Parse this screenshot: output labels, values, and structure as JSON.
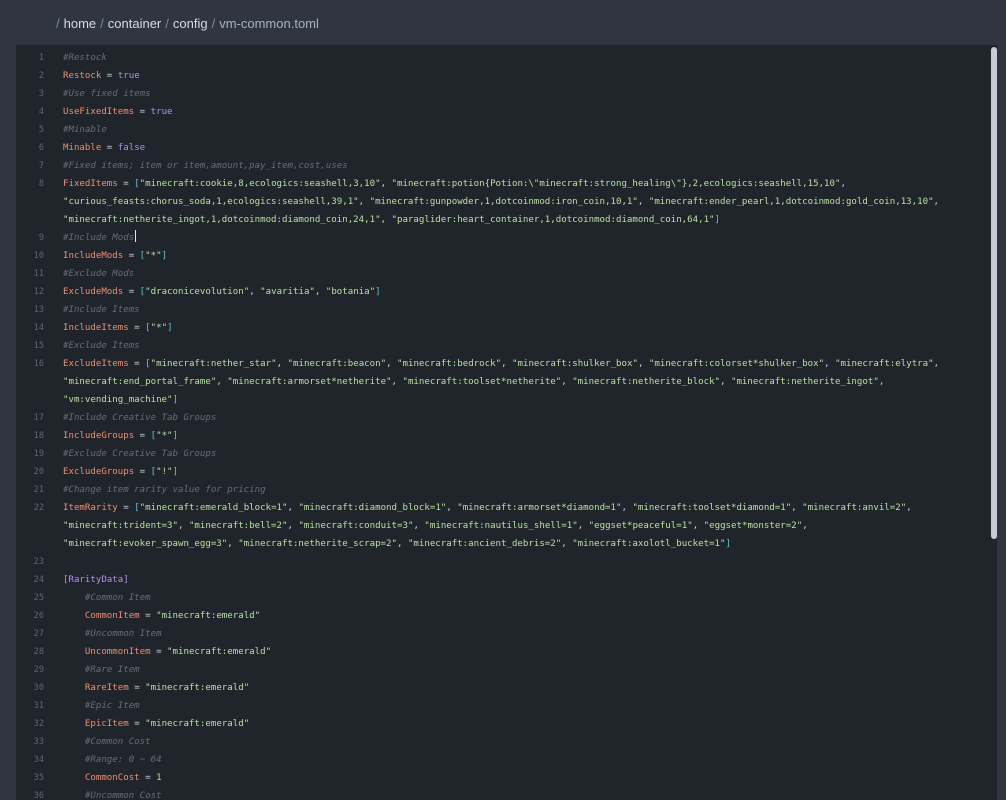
{
  "breadcrumb": {
    "items": [
      "home",
      "container",
      "config",
      "vm-common.toml"
    ]
  },
  "editor": {
    "lines": [
      {
        "num": "1",
        "tokens": [
          {
            "t": "#Restock",
            "c": "comment"
          }
        ]
      },
      {
        "num": "2",
        "tokens": [
          {
            "t": "Restock",
            "c": "key"
          },
          {
            "t": " = ",
            "c": "op"
          },
          {
            "t": "true",
            "c": "bool"
          }
        ]
      },
      {
        "num": "3",
        "tokens": [
          {
            "t": "#Use fixed items",
            "c": "comment"
          }
        ]
      },
      {
        "num": "4",
        "tokens": [
          {
            "t": "UseFixedItems",
            "c": "key"
          },
          {
            "t": " = ",
            "c": "op"
          },
          {
            "t": "true",
            "c": "bool"
          }
        ]
      },
      {
        "num": "5",
        "tokens": [
          {
            "t": "#Minable",
            "c": "comment"
          }
        ]
      },
      {
        "num": "6",
        "tokens": [
          {
            "t": "Minable",
            "c": "key"
          },
          {
            "t": " = ",
            "c": "op"
          },
          {
            "t": "false",
            "c": "bool"
          }
        ]
      },
      {
        "num": "7",
        "tokens": [
          {
            "t": "#Fixed items; item or item,amount,pay_item,cost,uses",
            "c": "comment"
          }
        ]
      },
      {
        "num": "8",
        "tokens": [
          {
            "t": "FixedItems",
            "c": "key"
          },
          {
            "t": " = ",
            "c": "op"
          },
          {
            "t": "[",
            "c": "bracket"
          },
          {
            "t": "\"minecraft:cookie,8,ecologics:seashell,3,10\"",
            "c": "str"
          },
          {
            "t": ", ",
            "c": "plain"
          },
          {
            "t": "\"minecraft:potion{Potion:\\\"minecraft:strong_healing\\\"},2,ecologics:seashell,15,10\"",
            "c": "str"
          },
          {
            "t": ",",
            "c": "plain"
          }
        ]
      },
      {
        "num": "",
        "tokens": [
          {
            "t": "\"curious_feasts:chorus_soda,1,ecologics:seashell,39,1\"",
            "c": "str"
          },
          {
            "t": ", ",
            "c": "plain"
          },
          {
            "t": "\"minecraft:gunpowder,1,dotcoinmod:iron_coin,10,1\"",
            "c": "str"
          },
          {
            "t": ", ",
            "c": "plain"
          },
          {
            "t": "\"minecraft:ender_pearl,1,dotcoinmod:gold_coin,13,10\"",
            "c": "str"
          },
          {
            "t": ",",
            "c": "plain"
          }
        ]
      },
      {
        "num": "",
        "tokens": [
          {
            "t": "\"minecraft:netherite_ingot,1,dotcoinmod:diamond_coin,24,1\"",
            "c": "str"
          },
          {
            "t": ", ",
            "c": "plain"
          },
          {
            "t": "\"paraglider:heart_container,1,dotcoinmod:diamond_coin,64,1\"",
            "c": "str"
          },
          {
            "t": "]",
            "c": "bracket"
          }
        ]
      },
      {
        "num": "9",
        "cursor": true,
        "tokens": [
          {
            "t": "#Include Mods",
            "c": "comment"
          }
        ]
      },
      {
        "num": "10",
        "tokens": [
          {
            "t": "IncludeMods",
            "c": "key"
          },
          {
            "t": " = ",
            "c": "op"
          },
          {
            "t": "[",
            "c": "bracket"
          },
          {
            "t": "\"*\"",
            "c": "str"
          },
          {
            "t": "]",
            "c": "bracket"
          }
        ]
      },
      {
        "num": "11",
        "tokens": [
          {
            "t": "#Exclude Mods",
            "c": "comment"
          }
        ]
      },
      {
        "num": "12",
        "tokens": [
          {
            "t": "ExcludeMods",
            "c": "key"
          },
          {
            "t": " = ",
            "c": "op"
          },
          {
            "t": "[",
            "c": "bracket"
          },
          {
            "t": "\"draconicevolution\"",
            "c": "str"
          },
          {
            "t": ", ",
            "c": "plain"
          },
          {
            "t": "\"avaritia\"",
            "c": "str"
          },
          {
            "t": ", ",
            "c": "plain"
          },
          {
            "t": "\"botania\"",
            "c": "str"
          },
          {
            "t": "]",
            "c": "bracket"
          }
        ]
      },
      {
        "num": "13",
        "tokens": [
          {
            "t": "#Include Items",
            "c": "comment"
          }
        ]
      },
      {
        "num": "14",
        "tokens": [
          {
            "t": "IncludeItems",
            "c": "key"
          },
          {
            "t": " = ",
            "c": "op"
          },
          {
            "t": "[",
            "c": "bracket"
          },
          {
            "t": "\"*\"",
            "c": "str"
          },
          {
            "t": "]",
            "c": "bracket"
          }
        ]
      },
      {
        "num": "15",
        "tokens": [
          {
            "t": "#Exclude Items",
            "c": "comment"
          }
        ]
      },
      {
        "num": "16",
        "tokens": [
          {
            "t": "ExcludeItems",
            "c": "key"
          },
          {
            "t": " = ",
            "c": "op"
          },
          {
            "t": "[",
            "c": "bracket"
          },
          {
            "t": "\"minecraft:nether_star\"",
            "c": "str"
          },
          {
            "t": ", ",
            "c": "plain"
          },
          {
            "t": "\"minecraft:beacon\"",
            "c": "str"
          },
          {
            "t": ", ",
            "c": "plain"
          },
          {
            "t": "\"minecraft:bedrock\"",
            "c": "str"
          },
          {
            "t": ", ",
            "c": "plain"
          },
          {
            "t": "\"minecraft:shulker_box\"",
            "c": "str"
          },
          {
            "t": ", ",
            "c": "plain"
          },
          {
            "t": "\"minecraft:colorset*shulker_box\"",
            "c": "str"
          },
          {
            "t": ", ",
            "c": "plain"
          },
          {
            "t": "\"minecraft:elytra\"",
            "c": "str"
          },
          {
            "t": ",",
            "c": "plain"
          }
        ]
      },
      {
        "num": "",
        "tokens": [
          {
            "t": "\"minecraft:end_portal_frame\"",
            "c": "str"
          },
          {
            "t": ", ",
            "c": "plain"
          },
          {
            "t": "\"minecraft:armorset*netherite\"",
            "c": "str"
          },
          {
            "t": ", ",
            "c": "plain"
          },
          {
            "t": "\"minecraft:toolset*netherite\"",
            "c": "str"
          },
          {
            "t": ", ",
            "c": "plain"
          },
          {
            "t": "\"minecraft:netherite_block\"",
            "c": "str"
          },
          {
            "t": ", ",
            "c": "plain"
          },
          {
            "t": "\"minecraft:netherite_ingot\"",
            "c": "str"
          },
          {
            "t": ",",
            "c": "plain"
          }
        ]
      },
      {
        "num": "",
        "tokens": [
          {
            "t": "\"vm:vending_machine\"",
            "c": "str"
          },
          {
            "t": "]",
            "c": "bracket"
          }
        ]
      },
      {
        "num": "17",
        "tokens": [
          {
            "t": "#Include Creative Tab Groups",
            "c": "comment"
          }
        ]
      },
      {
        "num": "18",
        "tokens": [
          {
            "t": "IncludeGroups",
            "c": "key"
          },
          {
            "t": " = ",
            "c": "op"
          },
          {
            "t": "[",
            "c": "bracket"
          },
          {
            "t": "\"*\"",
            "c": "str"
          },
          {
            "t": "]",
            "c": "bracket"
          }
        ]
      },
      {
        "num": "19",
        "tokens": [
          {
            "t": "#Exclude Creative Tab Groups",
            "c": "comment"
          }
        ]
      },
      {
        "num": "20",
        "tokens": [
          {
            "t": "ExcludeGroups",
            "c": "key"
          },
          {
            "t": " = ",
            "c": "op"
          },
          {
            "t": "[",
            "c": "bracket"
          },
          {
            "t": "\"!\"",
            "c": "str"
          },
          {
            "t": "]",
            "c": "bracket"
          }
        ]
      },
      {
        "num": "21",
        "tokens": [
          {
            "t": "#Change item rarity value for pricing",
            "c": "comment"
          }
        ]
      },
      {
        "num": "22",
        "tokens": [
          {
            "t": "ItemRarity",
            "c": "key"
          },
          {
            "t": " = ",
            "c": "op"
          },
          {
            "t": "[",
            "c": "bracket"
          },
          {
            "t": "\"minecraft:emerald_block=1\"",
            "c": "str"
          },
          {
            "t": ", ",
            "c": "plain"
          },
          {
            "t": "\"minecraft:diamond_block=1\"",
            "c": "str"
          },
          {
            "t": ", ",
            "c": "plain"
          },
          {
            "t": "\"minecraft:armorset*diamond=1\"",
            "c": "str"
          },
          {
            "t": ", ",
            "c": "plain"
          },
          {
            "t": "\"minecraft:toolset*diamond=1\"",
            "c": "str"
          },
          {
            "t": ", ",
            "c": "plain"
          },
          {
            "t": "\"minecraft:anvil=2\"",
            "c": "str"
          },
          {
            "t": ",",
            "c": "plain"
          }
        ]
      },
      {
        "num": "",
        "tokens": [
          {
            "t": "\"minecraft:trident=3\"",
            "c": "str"
          },
          {
            "t": ", ",
            "c": "plain"
          },
          {
            "t": "\"minecraft:bell=2\"",
            "c": "str"
          },
          {
            "t": ", ",
            "c": "plain"
          },
          {
            "t": "\"minecraft:conduit=3\"",
            "c": "str"
          },
          {
            "t": ", ",
            "c": "plain"
          },
          {
            "t": "\"minecraft:nautilus_shell=1\"",
            "c": "str"
          },
          {
            "t": ", ",
            "c": "plain"
          },
          {
            "t": "\"eggset*peaceful=1\"",
            "c": "str"
          },
          {
            "t": ", ",
            "c": "plain"
          },
          {
            "t": "\"eggset*monster=2\"",
            "c": "str"
          },
          {
            "t": ",",
            "c": "plain"
          }
        ]
      },
      {
        "num": "",
        "tokens": [
          {
            "t": "\"minecraft:evoker_spawn_egg=3\"",
            "c": "str"
          },
          {
            "t": ", ",
            "c": "plain"
          },
          {
            "t": "\"minecraft:netherite_scrap=2\"",
            "c": "str"
          },
          {
            "t": ", ",
            "c": "plain"
          },
          {
            "t": "\"minecraft:ancient_debris=2\"",
            "c": "str"
          },
          {
            "t": ", ",
            "c": "plain"
          },
          {
            "t": "\"minecraft:axolotl_bucket=1\"",
            "c": "str"
          },
          {
            "t": "]",
            "c": "bracket"
          }
        ]
      },
      {
        "num": "23",
        "tokens": []
      },
      {
        "num": "24",
        "tokens": [
          {
            "t": "[RarityData]",
            "c": "section"
          }
        ]
      },
      {
        "num": "25",
        "tokens": [
          {
            "t": "    #Common Item",
            "c": "comment"
          }
        ]
      },
      {
        "num": "26",
        "tokens": [
          {
            "t": "    ",
            "c": "plain"
          },
          {
            "t": "CommonItem",
            "c": "key"
          },
          {
            "t": " = ",
            "c": "op"
          },
          {
            "t": "\"minecraft:emerald\"",
            "c": "str"
          }
        ]
      },
      {
        "num": "27",
        "tokens": [
          {
            "t": "    #Uncommon Item",
            "c": "comment"
          }
        ]
      },
      {
        "num": "28",
        "tokens": [
          {
            "t": "    ",
            "c": "plain"
          },
          {
            "t": "UncommonItem",
            "c": "key"
          },
          {
            "t": " = ",
            "c": "op"
          },
          {
            "t": "\"minecraft:emerald\"",
            "c": "str"
          }
        ]
      },
      {
        "num": "29",
        "tokens": [
          {
            "t": "    #Rare Item",
            "c": "comment"
          }
        ]
      },
      {
        "num": "30",
        "tokens": [
          {
            "t": "    ",
            "c": "plain"
          },
          {
            "t": "RareItem",
            "c": "key"
          },
          {
            "t": " = ",
            "c": "op"
          },
          {
            "t": "\"minecraft:emerald\"",
            "c": "str"
          }
        ]
      },
      {
        "num": "31",
        "tokens": [
          {
            "t": "    #Epic Item",
            "c": "comment"
          }
        ]
      },
      {
        "num": "32",
        "tokens": [
          {
            "t": "    ",
            "c": "plain"
          },
          {
            "t": "EpicItem",
            "c": "key"
          },
          {
            "t": " = ",
            "c": "op"
          },
          {
            "t": "\"minecraft:emerald\"",
            "c": "str"
          }
        ]
      },
      {
        "num": "33",
        "tokens": [
          {
            "t": "    #Common Cost",
            "c": "comment"
          }
        ]
      },
      {
        "num": "34",
        "tokens": [
          {
            "t": "    #Range: 0 ~ 64",
            "c": "comment"
          }
        ]
      },
      {
        "num": "35",
        "tokens": [
          {
            "t": "    ",
            "c": "plain"
          },
          {
            "t": "CommonCost",
            "c": "key"
          },
          {
            "t": " = ",
            "c": "op"
          },
          {
            "t": "1",
            "c": "num"
          }
        ]
      },
      {
        "num": "36",
        "tokens": [
          {
            "t": "    #Uncommon Cost",
            "c": "comment"
          }
        ]
      }
    ]
  }
}
